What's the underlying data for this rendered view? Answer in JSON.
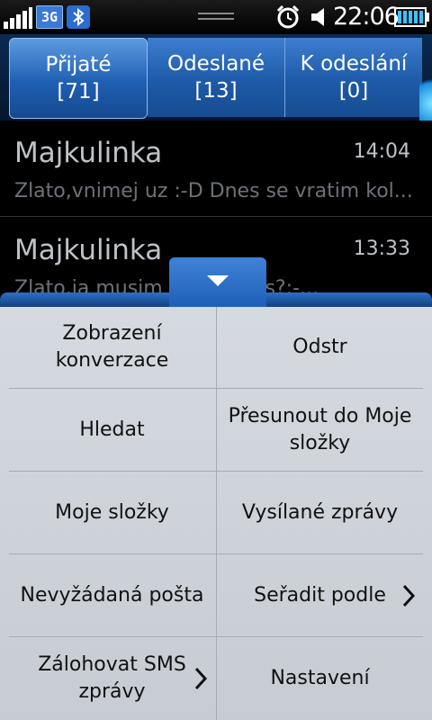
{
  "status_bar": {
    "network": "3G",
    "time": "22:06",
    "icons": [
      "signal-icon",
      "3g-icon",
      "bluetooth-icon",
      "drag-handle-icon",
      "alarm-icon",
      "speaker-icon",
      "battery-icon"
    ]
  },
  "tabs": [
    {
      "label": "Přijaté",
      "count": "[71]",
      "active": true
    },
    {
      "label": "Odeslané",
      "count": "[13]",
      "active": false
    },
    {
      "label": "K odeslání",
      "count": "[0]",
      "active": false
    }
  ],
  "messages": [
    {
      "sender": "Majkulinka",
      "time": "14:04",
      "preview": "Zlato,vnimej uz :-D Dnes se vratim kol..."
    },
    {
      "sender": "Majkulinka",
      "time": "13:33",
      "preview": "Zlato,ja musim                    z prace,vis?:-..."
    }
  ],
  "menu": {
    "items": [
      {
        "label": "Zobrazení konverzace",
        "chevron": false
      },
      {
        "label": "Odstr",
        "chevron": false
      },
      {
        "label": "Hledat",
        "chevron": false
      },
      {
        "label": "Přesunout do Moje složky",
        "chevron": false
      },
      {
        "label": "Moje složky",
        "chevron": false
      },
      {
        "label": "Vysílané zprávy",
        "chevron": false
      },
      {
        "label": "Nevyžádaná pošta",
        "chevron": false
      },
      {
        "label": "Seřadit podle",
        "chevron": true
      },
      {
        "label": "Zálohovat SMS zprávy",
        "chevron": true
      },
      {
        "label": "Nastavení",
        "chevron": false
      }
    ]
  },
  "colors": {
    "accent": "#1f5fb3",
    "menu_bg": "#d0d5db",
    "list_bg": "#000000"
  }
}
